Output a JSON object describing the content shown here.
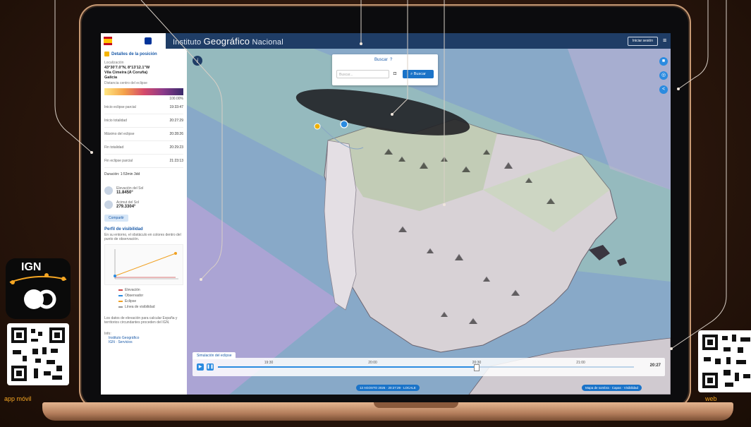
{
  "header": {
    "title_prefix": "Instituto",
    "title_main": "Geográfico",
    "title_suffix": "Nacional",
    "button_label": "Iniciar sesión"
  },
  "sidebar": {
    "title": "Detalles de la posición",
    "location_label": "Localización",
    "coords": "43°30'7.0\"N, 8°13'12.1\"W",
    "place": "Vila Cimeira (A Coruña)",
    "region": "Galicia",
    "gradient_label": "Distancia centro del eclipse",
    "gradient_value": "100.00%",
    "rows": [
      {
        "label": "Inicio eclipse parcial",
        "value": "19:33:47"
      },
      {
        "label": "Inicio totalidad",
        "value": "20:27:29"
      },
      {
        "label": "Máximo del eclipse",
        "value": "20:28:26"
      },
      {
        "label": "Fin totalidad",
        "value": "20:29:23"
      },
      {
        "label": "Fin eclipse parcial",
        "value": "21:23:13"
      }
    ],
    "duration": "Duración: 1:53min 3dd",
    "metric1": {
      "label": "Elevación del Sol",
      "value": "11.8450°"
    },
    "metric2": {
      "label": "Acimut del Sol",
      "value": "279.3304°"
    },
    "share_btn": "Compartir",
    "profile_title": "Perfil de visibilidad",
    "profile_desc": "En su entorno, el obstáculo en colores dentro del punto de observación.",
    "legend": [
      "Elevación",
      "Observador",
      "Eclipse",
      "Línea de visibilidad"
    ],
    "footnote": "Los datos de elevación para calcular España y territorios circundantes proceden del IGN.",
    "links_title": "Info:",
    "links": [
      "Instituto Geográfico",
      "IGN · Servicios"
    ]
  },
  "search": {
    "tab1": "Buscar",
    "tab2": "?",
    "placeholder": "Buscar...",
    "button": "Buscar"
  },
  "timeline": {
    "tab": "Simulación del eclipse",
    "labels": [
      "19:30",
      "20:00",
      "20:30",
      "21:00"
    ],
    "progress": 0.62,
    "time": "20:27"
  },
  "bottom": {
    "left_pill": "12 AGOSTO 2026 · 20:27:29 · LOCALE",
    "right_pill": "Mapa de sombra · Capas · Visibilidad"
  },
  "promo": {
    "app_name": "IGN",
    "app_caption": "app móvil",
    "web_caption": "web"
  },
  "colors": {
    "header": "#1f3d66",
    "accent": "#2b8be0",
    "promo_text": "#f5a623"
  }
}
